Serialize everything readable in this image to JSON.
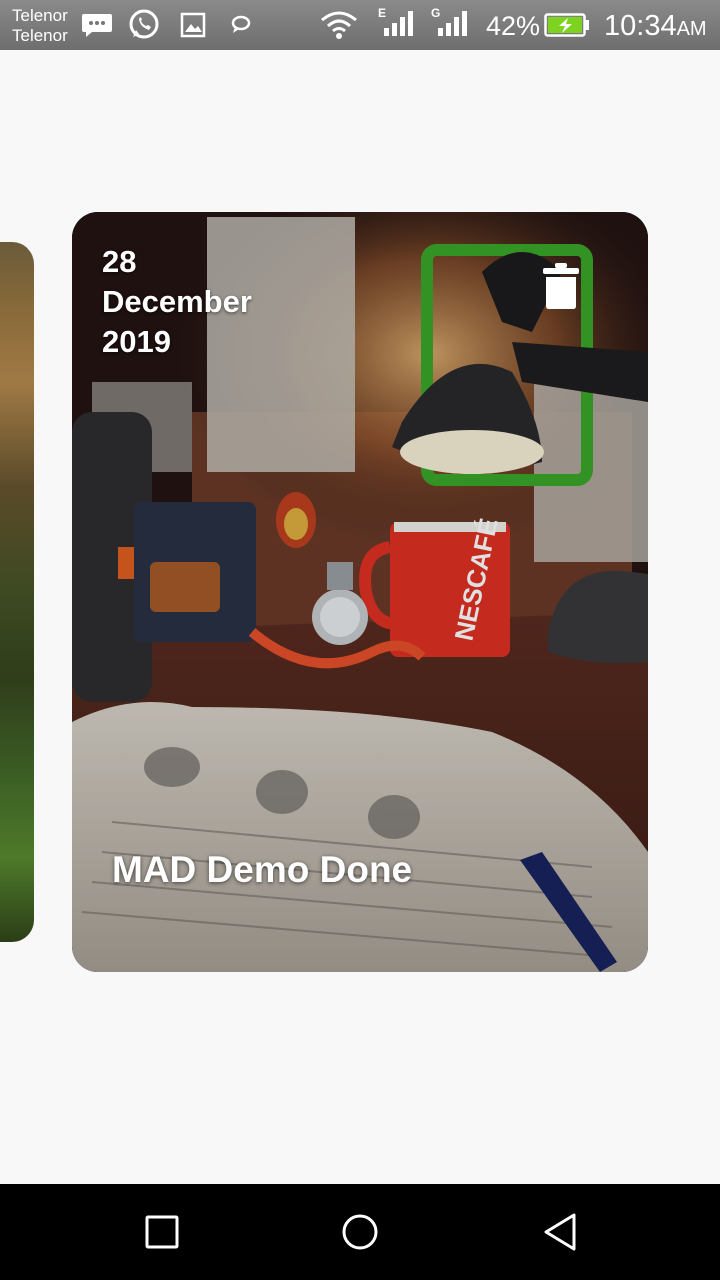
{
  "status_bar": {
    "carrier_1": "Telenor",
    "carrier_2": "Telenor",
    "network_1": "E",
    "network_2": "G",
    "battery_percent": "42%",
    "time": "10:34",
    "time_suffix": "AM",
    "notification_icons": [
      "message-icon",
      "whatsapp-icon",
      "gallery-icon",
      "chat-bubble-icon"
    ]
  },
  "card": {
    "date_day": "28",
    "date_month": "December",
    "date_year": "2019",
    "title": "MAD Demo Done",
    "delete_icon": "trash-icon"
  },
  "nav_bar": {
    "buttons": [
      "recent-apps-icon",
      "home-icon",
      "back-icon"
    ]
  },
  "colors": {
    "background": "#f8f8f8",
    "card_text": "#ffffff",
    "battery": "#7ed321"
  }
}
